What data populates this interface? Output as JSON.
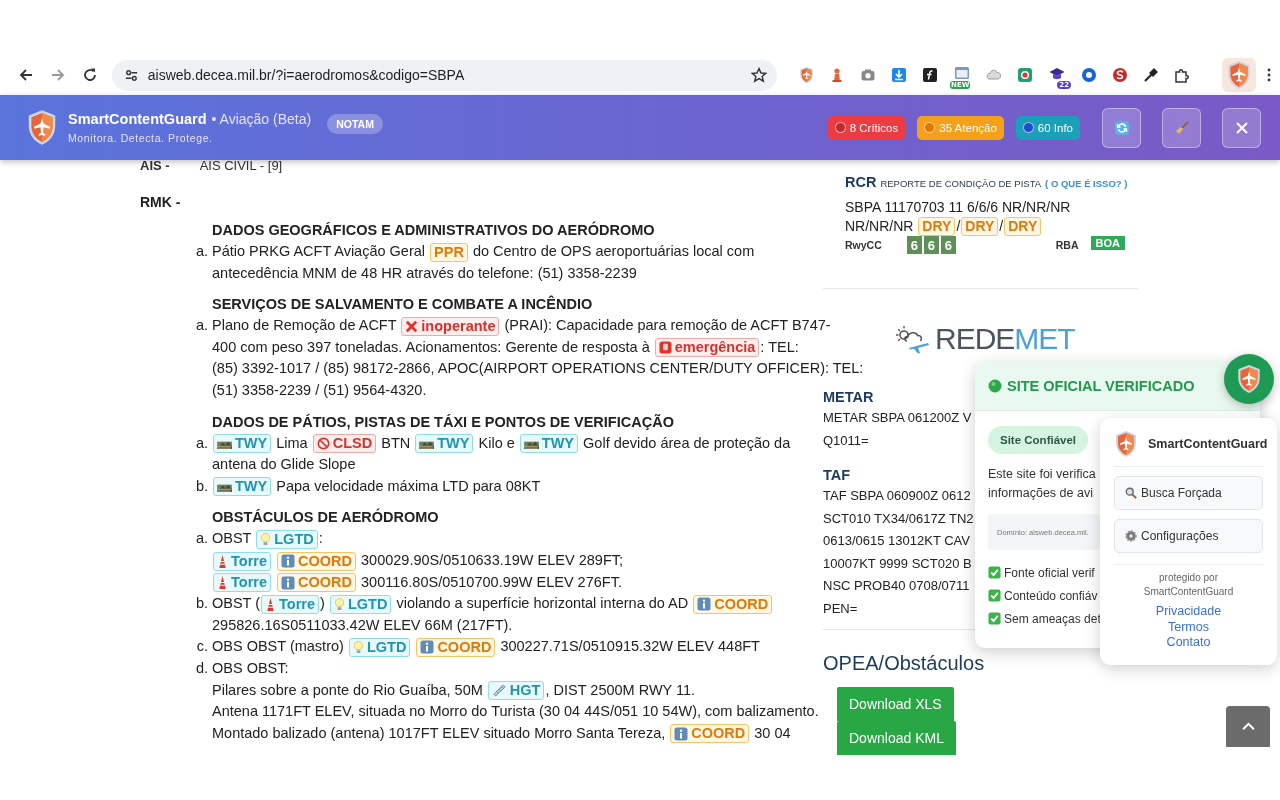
{
  "browser": {
    "url": "aisweb.decea.mil.br/?i=aerodromos&codigo=SBPA",
    "new_badge": "NEW",
    "count_badge": "22"
  },
  "banner": {
    "name": "SmartContentGuard",
    "suffix": "• Aviação (Beta)",
    "tagline": "Monitora. Detecta. Protege.",
    "mode": "NOTAM",
    "counters": [
      {
        "kind": "critical",
        "color": "#c62828",
        "label": "8 Críticos"
      },
      {
        "kind": "warning",
        "color": "#e07b00",
        "label": "35 Atenção"
      },
      {
        "kind": "info",
        "color": "#1a4fd0",
        "label": "60 Info"
      }
    ]
  },
  "notam": {
    "ais": [
      "AIS -",
      "AIS CIVIL - [9]"
    ],
    "rmk": "RMK -",
    "sections": [
      {
        "heading": "DADOS GEOGRÁFICOS E ADMINISTRATIVOS DO AERÓDROMO",
        "items": [
          {
            "marker": "a.",
            "lines": [
              [
                "Pátio PRKG ACFT Aviação Geral ",
                {
                  "kind": "plain",
                  "text": "PPR"
                },
                " do Centro de OPS aeroportuárias local com"
              ],
              [
                "antecedência MNM de 48 HR através do telefone: (51) 3358-2239"
              ]
            ]
          }
        ]
      },
      {
        "heading": "SERVIÇOS DE SALVAMENTO E COMBATE A INCÊNDIO",
        "items": [
          {
            "marker": "a.",
            "lines": [
              [
                "Plano de Remoção de ACFT ",
                {
                  "kind": "cross",
                  "text": "inoperante"
                },
                " (PRAI): Capacidade para remoção de ACFT B747-"
              ],
              [
                "400 com peso 397 toneladas. Acionamentos: Gerente de resposta à ",
                {
                  "kind": "alarm",
                  "text": "emergência"
                },
                ": TEL:"
              ],
              [
                "(85) 3392-1017 / (85) 98172-2866, APOC(AIRPORT OPERATIONS CENTER/DUTY OFFICER): TEL:"
              ],
              [
                "(51) 3358-2239 / (51) 9564-4320."
              ]
            ]
          }
        ]
      },
      {
        "heading": "DADOS DE PÁTIOS, PISTAS DE TÁXI E PONTOS DE VERIFICAÇÃO",
        "items": [
          {
            "marker": "a.",
            "lines": [
              [
                {
                  "kind": "rail",
                  "text": "TWY"
                },
                " Lima ",
                {
                  "kind": "blocked",
                  "text": "CLSD"
                },
                " BTN ",
                {
                  "kind": "rail",
                  "text": "TWY"
                },
                " Kilo e ",
                {
                  "kind": "rail",
                  "text": "TWY"
                },
                " Golf devido área de proteção da"
              ],
              [
                "antena do Glide Slope"
              ]
            ]
          },
          {
            "marker": "b.",
            "lines": [
              [
                {
                  "kind": "rail",
                  "text": "TWY"
                },
                " Papa velocidade máxima LTD para 08KT"
              ]
            ]
          }
        ]
      },
      {
        "heading": "OBSTÁCULOS DE AERÓDROMO",
        "items": [
          {
            "marker": "a.",
            "lines": [
              [
                "OBST ",
                {
                  "kind": "bulb",
                  "text": "LGTD"
                },
                ":"
              ],
              [
                {
                  "kind": "tower",
                  "text": "Torre"
                },
                {
                  "kind": "info",
                  "text": "COORD"
                },
                " 300029.90S/0510633.19W ELEV 289FT;"
              ],
              [
                {
                  "kind": "tower",
                  "text": "Torre"
                },
                {
                  "kind": "info",
                  "text": "COORD"
                },
                " 300116.80S/0510700.99W ELEV 276FT."
              ]
            ]
          },
          {
            "marker": "b.",
            "lines": [
              [
                "OBST (",
                {
                  "kind": "tower",
                  "text": "Torre"
                },
                ") ",
                {
                  "kind": "bulb",
                  "text": "LGTD"
                },
                " violando a superfície horizontal interna do AD ",
                {
                  "kind": "info",
                  "text": "COORD"
                }
              ],
              [
                "295826.16S0511033.42W ELEV 66M (217FT)."
              ]
            ]
          },
          {
            "marker": "c.",
            "lines": [
              [
                "OBS OBST (mastro) ",
                {
                  "kind": "bulb",
                  "text": "LGTD"
                },
                {
                  "kind": "info",
                  "text": "COORD"
                },
                " 300227.71S/0510915.32W ELEV 448FT"
              ]
            ]
          },
          {
            "marker": "d.",
            "lines": [
              [
                "OBS OBST:"
              ],
              [
                "Pilares sobre a ponte do Rio Guaíba, 50M ",
                {
                  "kind": "ruler",
                  "text": "HGT"
                },
                ", DIST 2500M RWY 11."
              ],
              [
                "Antena 1171FT ELEV, situada no Morro do Turista (30 04 44S/051 10 54W), com balizamento."
              ],
              [
                "Montado balizado (antena) 1017FT ELEV situado Morro Santa Tereza, ",
                {
                  "kind": "info",
                  "text": "COORD"
                },
                " 30 04"
              ]
            ]
          }
        ]
      }
    ]
  },
  "rcr": {
    "title": "RCR",
    "subtitle": "REPORTE DE CONDIÇÃO DE PISTA",
    "link": "( O QUE É ISSO? )",
    "report": "SBPA 11170703 11 6/6/6 NR/NR/NR",
    "conditions": [
      "NR/NR/NR ",
      {
        "kind": "plain",
        "text": "DRY"
      },
      "/",
      {
        "kind": "plain",
        "text": "DRY"
      },
      "/",
      {
        "kind": "plain",
        "text": "DRY"
      }
    ],
    "rwycc_label": "RwyCC",
    "rwycc": [
      "6",
      "6",
      "6"
    ],
    "rba_label": "RBA",
    "rba": "BOA"
  },
  "redemet": {
    "parts": [
      "REDE",
      "MET"
    ]
  },
  "metar": {
    "title": "METAR",
    "lines": [
      "METAR SBPA 061200Z V",
      "Q1011="
    ]
  },
  "taf": {
    "title": "TAF",
    "lines": [
      "TAF SBPA 060900Z 0612",
      "SCT010 TX34/0617Z TN2",
      "0613/0615 13012KT CAV",
      "10007KT 9999 SCT020 B",
      "NSC PROB40 0708/0711",
      "PEN="
    ]
  },
  "opea": {
    "title": "OPEA/Obstáculos",
    "buttons": [
      "Download XLS",
      "Download KML"
    ]
  },
  "verify_popup": {
    "title": "SITE OFICIAL VERIFICADO",
    "pill": "Site Confiável",
    "text_lines": [
      "Este site foi verifica",
      "informações de avi"
    ],
    "domain": "Domínio: aisweb.decea.mil.",
    "checks": [
      "Fonte oficial verif",
      "Conteúdo confiáv",
      "Sem ameaças det"
    ]
  },
  "guard_menu": {
    "brand": "SmartContentGuard",
    "actions": [
      {
        "kind": "search",
        "label": "Busca Forçada"
      },
      {
        "kind": "settings",
        "label": "Configurações"
      }
    ],
    "footer": [
      "protegido por",
      "SmartContentGuard"
    ],
    "links": [
      "Privacidade",
      "Termos",
      "Contato"
    ]
  }
}
